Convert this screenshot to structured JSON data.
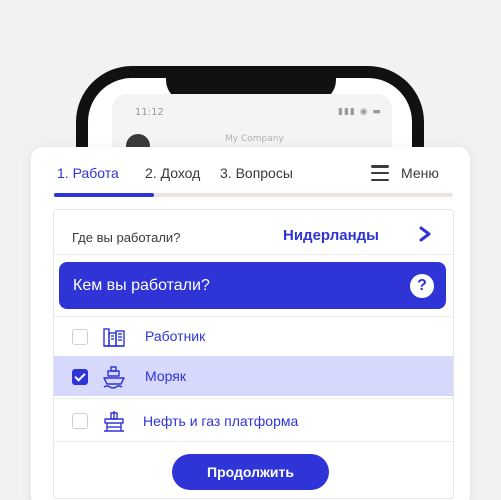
{
  "background_phone": {
    "time": "11:12",
    "status": "▮▮▮ ◉ ▬",
    "company_label": "My Company"
  },
  "tabs": [
    {
      "label": "1. Работа",
      "active": true
    },
    {
      "label": "2. Доход",
      "active": false
    },
    {
      "label": "3. Вопросы",
      "active": false
    }
  ],
  "menu": {
    "label": "Меню",
    "icon": "hamburger-icon"
  },
  "progress": {
    "fraction": 0.25
  },
  "where": {
    "label": "Где вы работали?",
    "value": "Нидерланды",
    "icon": "chevron-right-icon"
  },
  "question": {
    "text": "Кем вы работали?",
    "help_icon": "?"
  },
  "options": [
    {
      "label": "Работник",
      "icon": "factory-icon",
      "checked": false
    },
    {
      "label": "Моряк",
      "icon": "ship-icon",
      "checked": true
    },
    {
      "label": "Нефть и газ платформа",
      "icon": "oil-rig-icon",
      "checked": false
    }
  ],
  "continue_button": {
    "label": "Продолжить"
  },
  "colors": {
    "accent": "#2f34d6",
    "selected_row": "#d6d9fb",
    "progress_track": "#ece4e2"
  }
}
